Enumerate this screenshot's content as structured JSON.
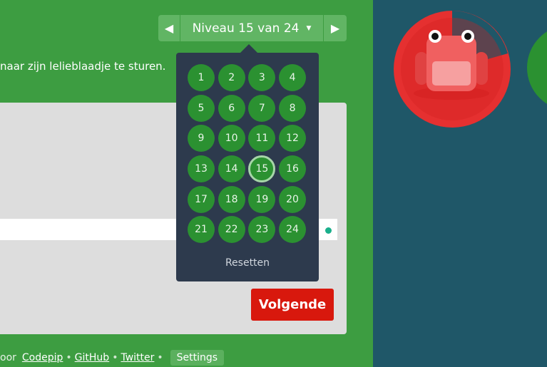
{
  "header": {
    "level_title": "Niveau 15 van 24",
    "prev_icon": "triangle-left-icon",
    "next_icon": "triangle-right-icon",
    "dropdown_icon": "caret-down-icon"
  },
  "instructions": "naar zijn lelieblaadje te sturen.",
  "level_menu": {
    "levels": [
      "1",
      "2",
      "3",
      "4",
      "5",
      "6",
      "7",
      "8",
      "9",
      "10",
      "11",
      "12",
      "13",
      "14",
      "15",
      "16",
      "17",
      "18",
      "19",
      "20",
      "21",
      "22",
      "23",
      "24"
    ],
    "current": "15",
    "reset_label": "Resetten"
  },
  "next_button": "Volgende",
  "footer": {
    "prefix": "oor",
    "link_codepip": "Codepip",
    "link_github": "GitHub",
    "link_twitter": "Twitter",
    "separator": "•",
    "settings_label": "Settings"
  },
  "colors": {
    "left_bg": "#3d9d41",
    "right_bg": "#1f5768",
    "menu_bg": "#2d3a4d",
    "level_circle": "#2b9131",
    "next_button": "#d8180d"
  }
}
